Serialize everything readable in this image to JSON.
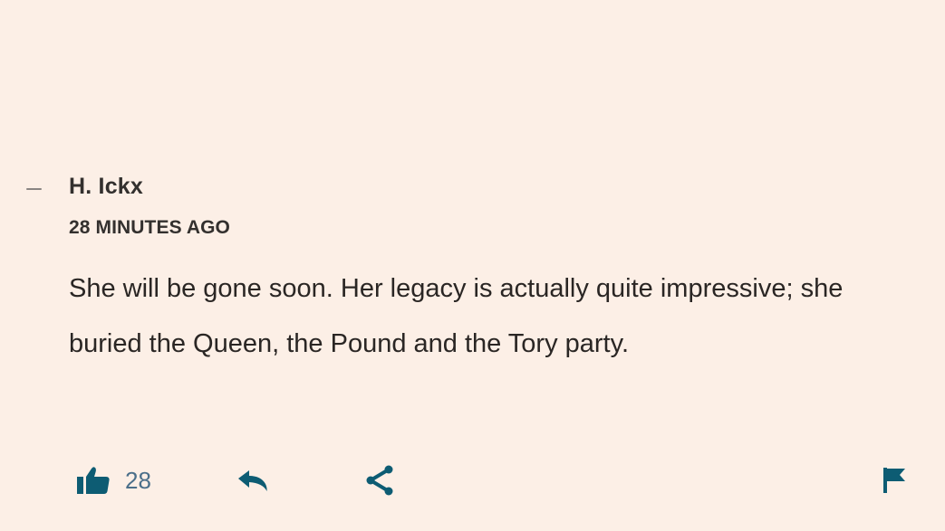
{
  "comment": {
    "author": "H. Ickx",
    "timestamp": "28 MINUTES AGO",
    "body": "She will be gone soon. Her legacy is actually quite impressive; she buried the Queen, the Pound and the Tory party.",
    "likes": "28"
  },
  "icons": {
    "collapse": "minus-icon",
    "like": "thumbs-up-icon",
    "reply": "reply-arrow-icon",
    "share": "share-icon",
    "report": "flag-icon"
  },
  "colors": {
    "background": "#fcefe6",
    "accent": "#0d5c73",
    "text": "#2a2624",
    "count": "#4b6f8a"
  }
}
